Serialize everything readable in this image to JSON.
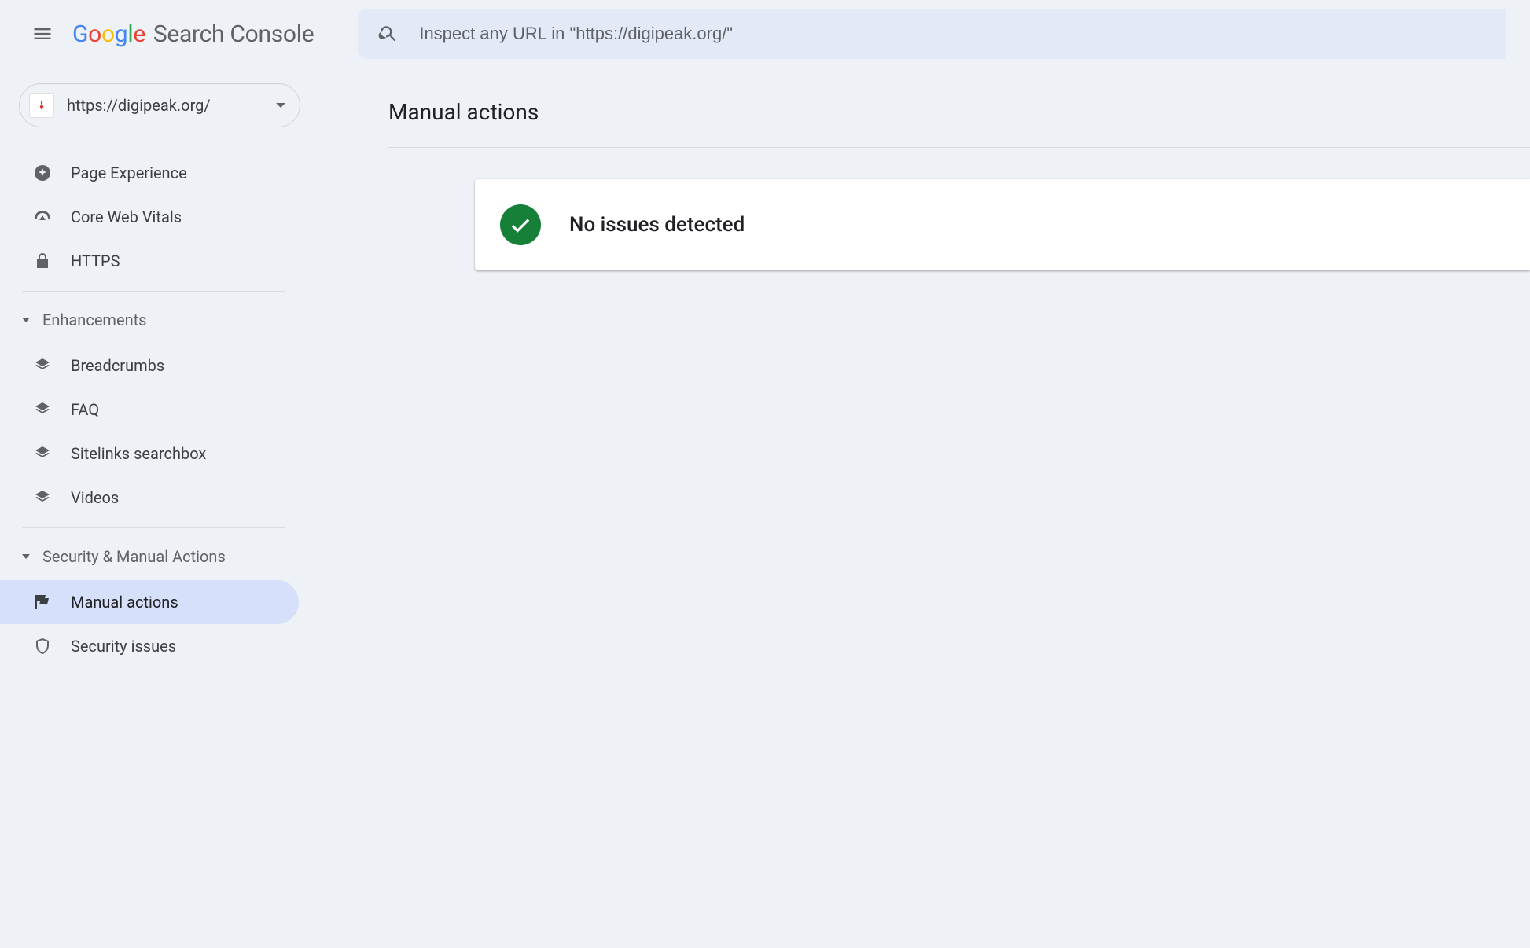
{
  "brand": {
    "google": [
      "G",
      "o",
      "o",
      "g",
      "l",
      "e"
    ],
    "suffix": "Search Console"
  },
  "search": {
    "placeholder": "Inspect any URL in \"https://digipeak.org/\""
  },
  "property": {
    "url": "https://digipeak.org/"
  },
  "sidebar": {
    "items_top": [
      {
        "label": "Page Experience"
      },
      {
        "label": "Core Web Vitals"
      },
      {
        "label": "HTTPS"
      }
    ],
    "group1": {
      "title": "Enhancements"
    },
    "items_enh": [
      {
        "label": "Breadcrumbs"
      },
      {
        "label": "FAQ"
      },
      {
        "label": "Sitelinks searchbox"
      },
      {
        "label": "Videos"
      }
    ],
    "group2": {
      "title": "Security & Manual Actions"
    },
    "items_sec": [
      {
        "label": "Manual actions"
      },
      {
        "label": "Security issues"
      }
    ]
  },
  "main": {
    "title": "Manual actions",
    "status": "No issues detected"
  }
}
